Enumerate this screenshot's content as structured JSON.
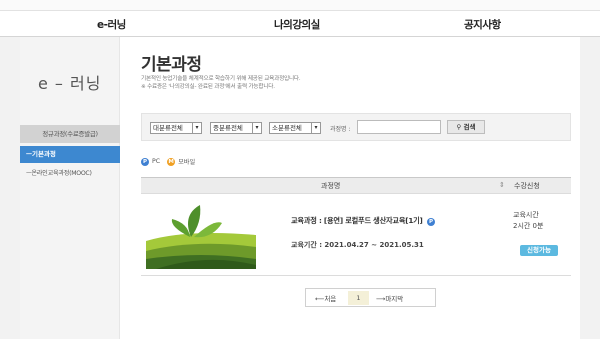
{
  "topnav": {
    "items": [
      {
        "label": "e-러닝"
      },
      {
        "label": "나의강의실"
      },
      {
        "label": "공지사항"
      }
    ]
  },
  "sidebar": {
    "logo": "e – 러닝",
    "section": "정규과정(수료증발급)",
    "items": [
      {
        "label": "ㅡ기본과정",
        "active": true
      },
      {
        "label": "ㅡ온라인교육과정(MOOC)"
      }
    ]
  },
  "main": {
    "title": "기본과정",
    "desc_line1": "기본적인 농업기술을 체계적으로 학습하기 위해 제공된 교육과정입니다.",
    "desc_line2": "※ 수료증은 '나의강의실- 완료된 과정'에서 출력 가능합니다."
  },
  "filter": {
    "select1": "대분류전체",
    "select2": "중분류전체",
    "select3": "소분류전체",
    "label": "과정명 :",
    "input_value": "",
    "button": "검색"
  },
  "legend": {
    "pc_badge": "P",
    "pc": "PC",
    "mobile_badge": "M",
    "mobile": "모바일"
  },
  "table": {
    "col_course": "과정명",
    "col_enroll_marker": "⇕",
    "col_enroll": "수강신청",
    "rows": [
      {
        "title": "교육과정 : [용연] 로컬푸드 생산자교육[1기]",
        "badge": "P",
        "period": "교육기간 : 2021.04.27 ~ 2021.05.31",
        "hours_label": "교육시간",
        "hours_value": "2시간 0분",
        "status": "신청가능"
      }
    ]
  },
  "pager": {
    "first": "⟵처음",
    "current": "1",
    "last": "⟶마지막"
  },
  "colors": {
    "accent": "#3d88d0",
    "status": "#5cb9e0",
    "pc_badge": "#3f80d2",
    "mobile_badge": "#f0a023"
  }
}
